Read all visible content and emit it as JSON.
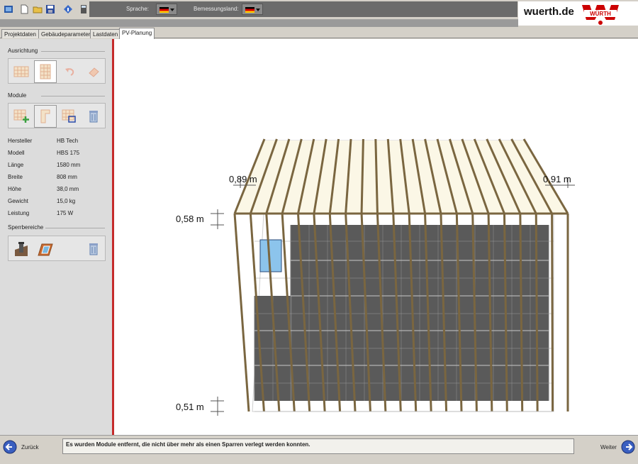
{
  "toolbar": {
    "language_label": "Sprache:",
    "country_label": "Bemessungsland:",
    "language_flag": "de-flag-icon",
    "country_flag": "de-flag-icon"
  },
  "brand": {
    "url": "wuerth.de",
    "logo_text": "WÜRTH",
    "color": "#cc0000"
  },
  "tabs": [
    {
      "label": "Projektdaten"
    },
    {
      "label": "Gebäudeparameter"
    },
    {
      "label": "Lastdaten"
    },
    {
      "label": "PV-Planung"
    }
  ],
  "left": {
    "orientation_title": "Ausrichtung",
    "modules_title": "Module",
    "blocked_title": "Sperrbereiche",
    "props": [
      {
        "label": "Hersteller",
        "value": "HB Tech"
      },
      {
        "label": "Modell",
        "value": "HBS 175"
      },
      {
        "label": "Länge",
        "value": "1580 mm"
      },
      {
        "label": "Breite",
        "value": "808 mm"
      },
      {
        "label": "Höhe",
        "value": "38,0 mm"
      },
      {
        "label": "Gewicht",
        "value": "15,0 kg"
      },
      {
        "label": "Leistung",
        "value": "175 W"
      }
    ]
  },
  "canvas": {
    "dim_top_left": "0,89 m",
    "dim_top_right": "0,91 m",
    "dim_left_upper": "0,58 m",
    "dim_left_lower": "0,51 m",
    "colors": {
      "module": "#5a5a5a",
      "rafter": "#7a6640",
      "roof_fill": "#fbf7e6",
      "window": "#8cc4ec"
    }
  },
  "bottom": {
    "back_label": "Zurück",
    "next_label": "Weiter",
    "status": "Es wurden Module entfernt, die nicht über mehr als einen Sparren verlegt werden konnten."
  }
}
